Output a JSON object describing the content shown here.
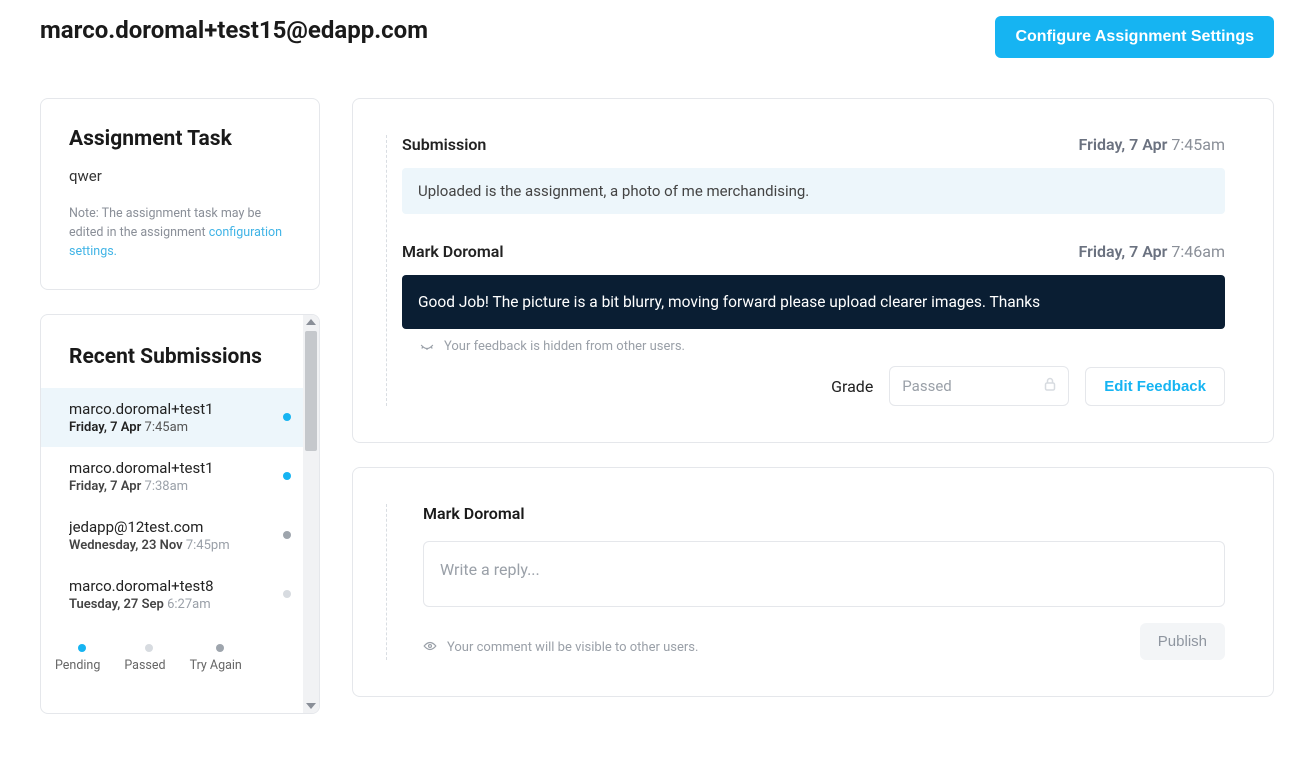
{
  "header": {
    "title": "marco.doromal+test15@edapp.com",
    "configure_button": "Configure Assignment Settings"
  },
  "task": {
    "heading": "Assignment Task",
    "value": "qwer",
    "note_prefix": "Note: The assignment task may be edited in the assignment ",
    "note_link": "configuration settings."
  },
  "recent": {
    "heading": "Recent Submissions",
    "items": [
      {
        "name": "marco.doromal+test1",
        "date_bold": "Friday, 7 Apr",
        "date_time": "7:45am",
        "status": "pending",
        "selected": true
      },
      {
        "name": "marco.doromal+test1",
        "date_bold": "Friday, 7 Apr",
        "date_time": "7:38am",
        "status": "pending",
        "selected": false
      },
      {
        "name": "jedapp@12test.com",
        "date_bold": "Wednesday, 23 Nov",
        "date_time": "7:45pm",
        "status": "tryagain",
        "selected": false
      },
      {
        "name": "marco.doromal+test8",
        "date_bold": "Tuesday, 27 Sep",
        "date_time": "6:27am",
        "status": "passed",
        "selected": false
      }
    ],
    "legend": {
      "pending": "Pending",
      "passed": "Passed",
      "tryagain": "Try Again"
    }
  },
  "thread": {
    "submission": {
      "label": "Submission",
      "date": "Friday, 7 Apr",
      "time": "7:45am",
      "body": "Uploaded is the assignment, a photo of me merchandising."
    },
    "feedback": {
      "author": "Mark Doromal",
      "date": "Friday, 7 Apr",
      "time": "7:46am",
      "body": "Good Job! The picture is a bit blurry, moving forward please upload clearer images. Thanks",
      "hidden_note": "Your feedback is hidden from other users."
    },
    "grade": {
      "label": "Grade",
      "value": "Passed",
      "edit_button": "Edit Feedback"
    }
  },
  "reply": {
    "author": "Mark Doromal",
    "placeholder": "Write a reply...",
    "visible_note": "Your comment will be visible to other users.",
    "publish_button": "Publish"
  }
}
